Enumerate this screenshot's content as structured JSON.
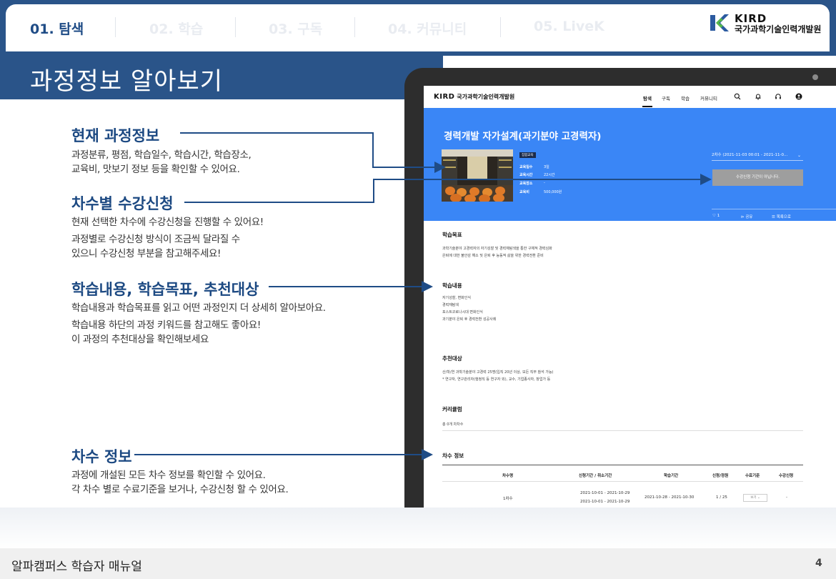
{
  "nav": {
    "tabs": [
      {
        "label": "01. 탐색",
        "active": true
      },
      {
        "label": "02. 학습",
        "active": false
      },
      {
        "label": "03. 구독",
        "active": false
      },
      {
        "label": "04. 커뮤니티",
        "active": false
      },
      {
        "label": "05. LiveK",
        "active": false
      }
    ],
    "logo": {
      "name": "KIRD",
      "org": "국가과학기술인력개발원"
    }
  },
  "page_title": "과정정보 알아보기",
  "sections": [
    {
      "title": "현재 과정정보",
      "lines": [
        "과정분류, 평점, 학습일수, 학습시간, 학습장소,",
        "교육비, 맛보기 정보 등을 확인할 수 있어요."
      ]
    },
    {
      "title": "차수별 수강신청",
      "lines": [
        "현재 선택한 차수에 수강신청을 진행할 수 있어요!",
        "과정별로 수강신청 방식이 조금씩 달라질 수",
        "있으니 수강신청 부분을 참고해주세요!"
      ]
    },
    {
      "title": "학습내용, 학습목표, 추천대상",
      "lines": [
        "학습내용과 학습목표를 읽고 어떤 과정인지 더 상세히 알아보아요.",
        "학습내용 하단의 과정 키워드를 참고해도 좋아요!",
        "이 과정의 추천대상을 확인해보세요"
      ]
    },
    {
      "title": "차수 정보",
      "lines": [
        "과정에 개설된 모든 차수 정보를 확인할 수 있어요.",
        "각 차수 별로 수료기준을 보거나, 수강신청 할 수 있어요."
      ]
    }
  ],
  "app": {
    "logo_brand": "KIRD",
    "logo_text": "국가과학기술인력개발원",
    "nav": [
      "탐색",
      "구독",
      "학습",
      "커뮤니티"
    ],
    "icons": [
      "search-icon",
      "bell-icon",
      "headset-icon",
      "user-icon"
    ],
    "course_title": "경력개발 자가설계(과기분야 고경력자)",
    "badge": "집합교육",
    "info": [
      {
        "key": "교육일수",
        "value": "3일"
      },
      {
        "key": "교육시간",
        "value": "22시간"
      },
      {
        "key": "교육장소",
        "value": "-"
      },
      {
        "key": "교육비",
        "value": "500,000원"
      }
    ],
    "session_select": "2차수 (2021-11-03 00:01 - 2021-11-0...",
    "apply_button": "수강신청 기간이 아닙니다.",
    "hero_actions": {
      "likes": "1",
      "share": "공유",
      "list": "목록으로"
    },
    "goal": {
      "title": "학습목표",
      "lines": [
        "과학기술분야 고경력자의 자기성찰 및 경력재탐색을 통한 구체적 경력심화",
        "은퇴에 대한 불안감 해소 및 은퇴 후 능동적 삶을 위한 경력전환 준비"
      ]
    },
    "content": {
      "title": "학습내용",
      "lines": [
        "자기성찰, 변화인식",
        "경력재탐색",
        "포스트코로나시대 변화인식",
        "과기분야 은퇴 후 경력전환 성공사례"
      ]
    },
    "target": {
      "title": "추천대상",
      "lines": [
        "산/학/연 과학기술분야 고경력 25명(입직 20년 이상, 모든 직무 참석 가능)",
        "* 연구자, 연구관리자(행정직 등 연구자 외), 교수, 기업종사자, 창업가 등"
      ]
    },
    "curriculum": {
      "title": "커리큘럼",
      "summary": "총 0개 차차수"
    },
    "session_info": {
      "title": "차수 정보",
      "headers": [
        "차수명",
        "신청기간 / 취소기간",
        "학습기간",
        "신청/정원",
        "수료기준",
        "수강신청"
      ],
      "row": {
        "name": "1차수",
        "apply_period": "2021-10-01 - 2021-10-29",
        "cancel_period": "2021-10-01 - 2021-10-29",
        "study_period": "2021-10-28 - 2021-10-30",
        "capacity": "1 / 25",
        "criteria": "보기",
        "apply": "-"
      }
    }
  },
  "footer": {
    "title": "알파캠퍼스 학습자 매뉴얼",
    "page": "4"
  }
}
